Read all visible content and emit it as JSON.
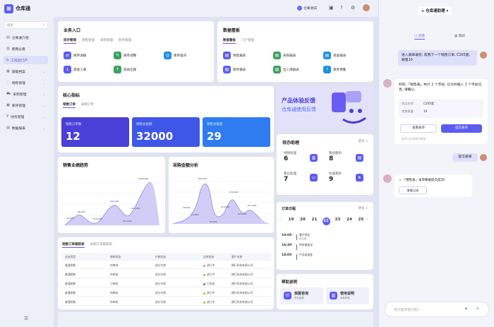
{
  "app": {
    "name": "仓库通"
  },
  "topbar": {
    "user_label": "仓库测试"
  },
  "sidebar": {
    "search_placeholder": "搜索",
    "items": [
      {
        "label": "仓库通介绍",
        "icon": "doc-icon",
        "active": false,
        "chev": false
      },
      {
        "label": "使用必看",
        "icon": "book-icon",
        "active": false,
        "chev": false
      },
      {
        "label": "工作台门户",
        "icon": "home-icon",
        "active": true,
        "chev": false
      },
      {
        "label": "基础档案",
        "icon": "folder-icon",
        "active": false,
        "chev": true
      },
      {
        "label": "销售管理",
        "icon": "sales-icon",
        "active": false,
        "chev": true
      },
      {
        "label": "采购管理",
        "icon": "cart-icon",
        "active": false,
        "chev": true
      },
      {
        "label": "库存管理",
        "icon": "box-icon",
        "active": false,
        "chev": true
      },
      {
        "label": "财务管理",
        "icon": "money-icon",
        "active": false,
        "chev": true
      },
      {
        "label": "数据报表",
        "icon": "report-icon",
        "active": false,
        "chev": true
      }
    ]
  },
  "business": {
    "title": "业务入口",
    "tabs": [
      "库存管理",
      "销售管理",
      "采购管理",
      "财务管理"
    ],
    "items": [
      "库存调拨",
      "库存调整",
      "库存盘点",
      "其他入库",
      "其他出库"
    ]
  },
  "databoard": {
    "title": "数据看板",
    "tabs": [
      "数据看板",
      "门户管理"
    ],
    "items": [
      "销售报表",
      "采购报表",
      "资金报表",
      "库存报表",
      "出入库报表",
      "库存预警"
    ]
  },
  "core": {
    "title": "核心指标",
    "tabs": [
      "销售订单",
      "采购订单"
    ],
    "kpis": [
      {
        "label": "销售订单数",
        "value": "12"
      },
      {
        "label": "销售总金额",
        "value": "32000"
      },
      {
        "label": "销售总数量",
        "value": "29"
      }
    ]
  },
  "banner": {
    "line1": "产品体验反馈",
    "line2": "仓库通使用反馈"
  },
  "todo": {
    "title": "待办助理",
    "more": "更多 >",
    "items": [
      {
        "label": "待我处理",
        "value": "6"
      },
      {
        "label": "我创建的",
        "value": "8"
      },
      {
        "label": "我已处理",
        "value": "7"
      },
      {
        "label": "抄送我的",
        "value": "9"
      }
    ]
  },
  "sales_trend": {
    "title": "销售业绩趋势"
  },
  "purchase": {
    "title": "采购金额分析"
  },
  "calendar": {
    "title": "订单日程",
    "more": "更多 >",
    "days": [
      "19",
      "20",
      "21",
      "22",
      "23",
      "24",
      "25"
    ],
    "events": [
      {
        "time": "10:00",
        "text": "客户拜访",
        "sub": "陈经理"
      },
      {
        "time": "16:30",
        "text": "供应商会议",
        "sub": ""
      },
      {
        "time": "18:00",
        "text": "产品培训会",
        "sub": ""
      }
    ]
  },
  "orders": {
    "tabs": [
      "销售订单跟踪表",
      "采购订单跟踪表"
    ],
    "headers": [
      "业务类型",
      "审核状态",
      "付款状态",
      "出库状态",
      "客户名称"
    ],
    "rows": [
      [
        "普通销售",
        "待审核",
        "部分付款",
        "进行中",
        "朗行科技有限公司"
      ],
      [
        "普通销售",
        "待审核",
        "部分付款",
        "进行中",
        "朗行科技有限公司"
      ],
      [
        "普通销售",
        "已审核",
        "部分付款",
        "已完成",
        "朗行科技有限公司"
      ],
      [
        "普通销售",
        "待审核",
        "部分付款",
        "进行中",
        "朗行科技有限公司"
      ],
      [
        "普通销售",
        "待审核",
        "部分付款",
        "进行中",
        "朗行科技有限公司"
      ]
    ]
  },
  "help": {
    "title": "帮助说明",
    "items": [
      {
        "label": "我要咨询",
        "sub": "联系客服"
      },
      {
        "label": "使用说明",
        "sub": "获取帮助"
      }
    ]
  },
  "chat": {
    "title": "仓库通助理",
    "tabs": [
      "对话",
      "帮助"
    ],
    "user_msg1": "进入表单填充: 帮我下一个销售订单, C205宽, 数量10",
    "bot_msg1": "好的,「销售表」共计 2 个字段, 已为你填入 2 个字段信息, 请确认:",
    "fields": [
      {
        "k": "商品名称",
        "v": "C205宽"
      },
      {
        "k": "销售数量",
        "v": "10"
      }
    ],
    "btn_view": "查看表单",
    "btn_submit": "提交表单",
    "hint": "你可以在表单中修改",
    "user_msg2": "提交表单",
    "bot_msg2": "「销售表」表单数据提交成功!",
    "btn_record": "查看记录",
    "input_placeholder": "有问题尽管问我~"
  },
  "colors": {
    "accent": "#5b5cf0",
    "kpi_dark": "#4a3fd6",
    "kpi_mid": "#3f57e6",
    "kpi_light": "#2e7cf0"
  }
}
